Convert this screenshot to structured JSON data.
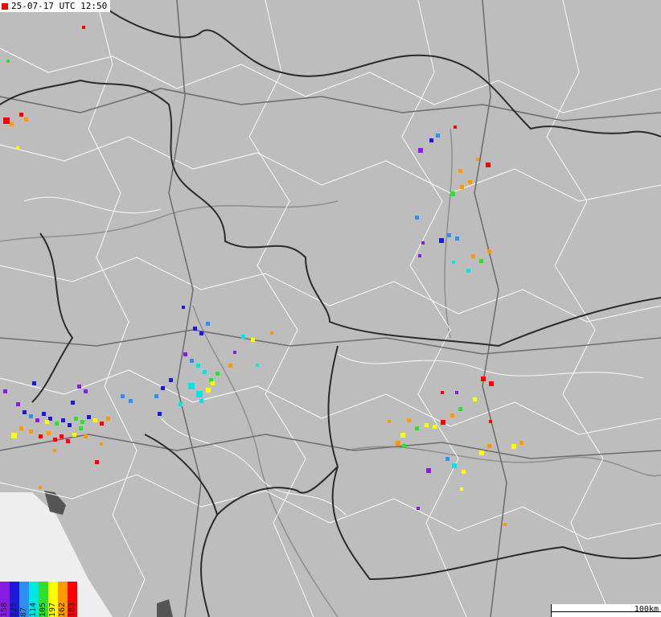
{
  "timestamp": "25-07-17 UTC 12:50",
  "scale_label": "100km",
  "legend": [
    {
      "label": "158",
      "color": "#8a1be0"
    },
    {
      "label": "125",
      "color": "#1a1ad8"
    },
    {
      "label": "87",
      "color": "#2f8ff0"
    },
    {
      "label": "114",
      "color": "#00e5e5"
    },
    {
      "label": "105",
      "color": "#2ee02e"
    },
    {
      "label": "197",
      "color": "#ffff00"
    },
    {
      "label": "162",
      "color": "#ff9900"
    },
    {
      "label": "183",
      "color": "#ff0000"
    }
  ],
  "colors": {
    "land": "#bdbdbd",
    "sea": "#eeeeee",
    "roads": "#ffffff",
    "borders": "#333333"
  }
}
